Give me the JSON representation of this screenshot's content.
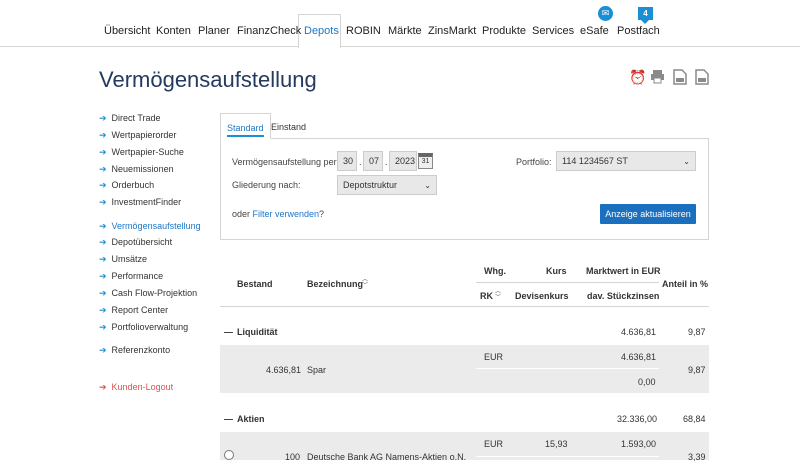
{
  "nav": {
    "items": [
      "Übersicht",
      "Konten",
      "Planer",
      "FinanzCheck",
      "Depots",
      "ROBIN",
      "Märkte",
      "ZinsMarkt",
      "Produkte",
      "Services",
      "eSafe",
      "Postfach"
    ],
    "postfach_count": "4"
  },
  "page_title": "Vermögensaufstellung",
  "sidebar": {
    "items": [
      "Direct Trade",
      "Wertpapierorder",
      "Wertpapier-Suche",
      "Neuemissionen",
      "Orderbuch",
      "InvestmentFinder",
      "Vermögensaufstellung",
      "Depotübersicht",
      "Umsätze",
      "Performance",
      "Cash Flow-Projektion",
      "Report Center",
      "Portfolioverwaltung"
    ],
    "referenzkonto": "Referenzkonto",
    "logout": "Kunden-Logout"
  },
  "tabs": {
    "standard": "Standard",
    "einstand": "Einstand"
  },
  "form": {
    "date_label": "Vermögensaufstellung per:",
    "day": "30",
    "month": "07",
    "year": "2023",
    "gliederung_label": "Gliederung nach:",
    "gliederung_value": "Depotstruktur",
    "portfolio_label": "Portfolio:",
    "portfolio_value": "114 1234567 ST",
    "filter_prefix": "oder ",
    "filter_link": "Filter verwenden",
    "filter_suffix": "?",
    "submit": "Anzeige aktualisieren"
  },
  "table": {
    "headers": {
      "bestand": "Bestand",
      "bezeichnung": "Bezeichnung",
      "whg": "Whg.",
      "rk": "RK",
      "kurs": "Kurs",
      "devisenkurs": "Devisenkurs",
      "marktwert": "Marktwert in EUR",
      "stueckzinsen": "dav. Stückzinsen",
      "anteil": "Anteil in %"
    },
    "liquiditaet": {
      "label": "Liquidität",
      "marktwert": "4.636,81",
      "anteil": "9,87"
    },
    "spar": {
      "bestand": "4.636,81",
      "name": "Spar",
      "whg": "EUR",
      "marktwert": "4.636,81",
      "stueckzinsen": "0,00",
      "anteil": "9,87"
    },
    "aktien": {
      "label": "Aktien",
      "marktwert": "32.336,00",
      "anteil": "68,84"
    },
    "deutsche_bank": {
      "bestand": "100",
      "name": "Deutsche Bank AG Namens-Aktien o.N.",
      "whg": "EUR",
      "kurs": "15,93",
      "marktwert": "1.593,00",
      "anteil": "3,39"
    }
  }
}
